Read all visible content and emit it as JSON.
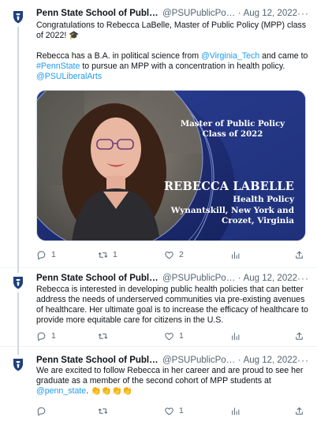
{
  "tweets": [
    {
      "author_name": "Penn State School of Public Poli...",
      "handle": "@PSUPublicPoli...",
      "separator": "·",
      "date": "Aug 12, 2022",
      "more": "···",
      "line1": "Congratulations to Rebecca LaBelle, Master of Public Policy (MPP) class of 2022! 🎓",
      "line2_pre": "Rebecca has a B.A. in political science from ",
      "mention_virginia": "@Virginia_Tech",
      "line2_mid": " and came to ",
      "hashtag": "#PennState",
      "line2_post": " to pursue an MPP with a concentration in health policy.",
      "mention_liberal": "@PSULiberalArts",
      "media": {
        "title": "Master of Public Policy Class of 2022",
        "name": "REBECCA LABELLE",
        "line_health": "Health Policy",
        "line_town": "Wynantskill, New York and",
        "line_city": "Crozet, Virginia"
      },
      "replies": "1",
      "retweets": "1",
      "likes": "2"
    },
    {
      "author_name": "Penn State School of Public Poli...",
      "handle": "@PSUPublicPoli...",
      "separator": "·",
      "date": "Aug 12, 2022",
      "more": "···",
      "text": "Rebecca is interested in developing public health policies that can better address the needs of underserved communities via pre-existing avenues of healthcare. Her ultimate goal is to increase the efficacy of healthcare to provide more equitable care for citizens in the U.S.",
      "replies": "1",
      "retweets": "",
      "likes": "1"
    },
    {
      "author_name": "Penn State School of Public Poli...",
      "handle": "@PSUPublicPoli...",
      "separator": "·",
      "date": "Aug 12, 2022",
      "more": "···",
      "text_pre": "We are excited to follow Rebecca in her career and are proud to see her graduate as a member of the second cohort of MPP students at ",
      "mention_penn": "@penn_state",
      "text_post": ". 👏👏👏👏",
      "replies": "",
      "retweets": "",
      "likes": "1"
    }
  ],
  "icons": {
    "avatar": "penn-state-shield-icon",
    "reply": "reply-icon",
    "retweet": "retweet-icon",
    "like": "heart-icon",
    "views": "views-bar-chart-icon",
    "share": "share-icon"
  },
  "colors": {
    "link": "#1d9bf0",
    "secondary_text": "#536471",
    "media_background": "#1c2b6b"
  }
}
